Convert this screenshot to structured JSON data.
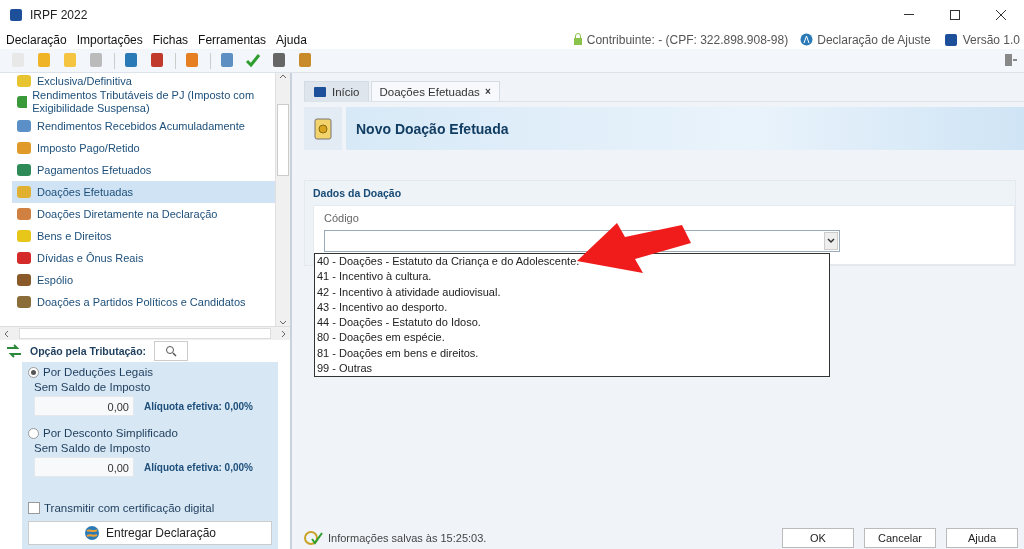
{
  "window": {
    "title": "IRPF 2022"
  },
  "menu": [
    {
      "label": "Declaração"
    },
    {
      "label": "Importações"
    },
    {
      "label": "Fichas"
    },
    {
      "label": "Ferramentas"
    },
    {
      "label": "Ajuda"
    }
  ],
  "header_info": {
    "taxpayer": "Contribuinte: - (CPF: 322.898.908-98)",
    "declaration_type": "Declaração de Ajuste",
    "version": "Versão 1.0"
  },
  "sidebar": {
    "items": [
      {
        "label": "Exclusiva/Definitiva",
        "selected": false
      },
      {
        "label": "Rendimentos Tributáveis de PJ (Imposto com Exigibilidade Suspensa)",
        "selected": false
      },
      {
        "label": "Rendimentos Recebidos Acumuladamente",
        "selected": false
      },
      {
        "label": "Imposto Pago/Retido",
        "selected": false
      },
      {
        "label": "Pagamentos Efetuados",
        "selected": false
      },
      {
        "label": "Doações Efetuadas",
        "selected": true
      },
      {
        "label": "Doações Diretamente na Declaração",
        "selected": false
      },
      {
        "label": "Bens e Direitos",
        "selected": false
      },
      {
        "label": "Dívidas e Ônus Reais",
        "selected": false
      },
      {
        "label": "Espólio",
        "selected": false
      },
      {
        "label": "Doações a Partidos Políticos e Candidatos",
        "selected": false
      }
    ]
  },
  "tax_option": {
    "title": "Opção pela Tributação:",
    "options": [
      {
        "label": "Por Deduções Legais",
        "selected": true,
        "sub_label": "Sem Saldo de Imposto",
        "value": "0,00",
        "rate": "Alíquota efetiva: 0,00%"
      },
      {
        "label": "Por Desconto Simplificado",
        "selected": false,
        "sub_label": "Sem Saldo de Imposto",
        "value": "0,00",
        "rate": "Alíquota efetiva: 0,00%"
      }
    ],
    "certificate": {
      "label": "Transmitir com certificação digital",
      "checked": false
    },
    "deliver_button": "Entregar Declaração"
  },
  "tabs": [
    {
      "label": "Início",
      "selected": false,
      "closable": false
    },
    {
      "label": "Doações Efetuadas",
      "selected": true,
      "closable": true
    }
  ],
  "close_tab_glyph": "×",
  "page_title": "Novo Doação Efetuada",
  "section": {
    "title": "Dados da Doação",
    "field_label": "Código",
    "dropdown": {
      "expanded": true,
      "options": [
        {
          "label": "40 - Doações - Estatuto da Criança e do Adolescente.",
          "selected": false
        },
        {
          "label": "41 - Incentivo à cultura.",
          "selected": false
        },
        {
          "label": "42 - Incentivo à atividade audiovisual.",
          "selected": false
        },
        {
          "label": "43 - Incentivo ao desporto.",
          "selected": false
        },
        {
          "label": "44 - Doações - Estatuto do Idoso.",
          "selected": false
        },
        {
          "label": "80 - Doações em espécie.",
          "selected": false
        },
        {
          "label": "81 - Doações em bens e direitos.",
          "selected": false
        },
        {
          "label": "99 - Outras",
          "selected": false
        }
      ]
    }
  },
  "status_bar": {
    "text": "Informações salvas às 15:25:03."
  },
  "buttons": [
    {
      "label": "OK"
    },
    {
      "label": "Cancelar"
    },
    {
      "label": "Ajuda"
    }
  ]
}
